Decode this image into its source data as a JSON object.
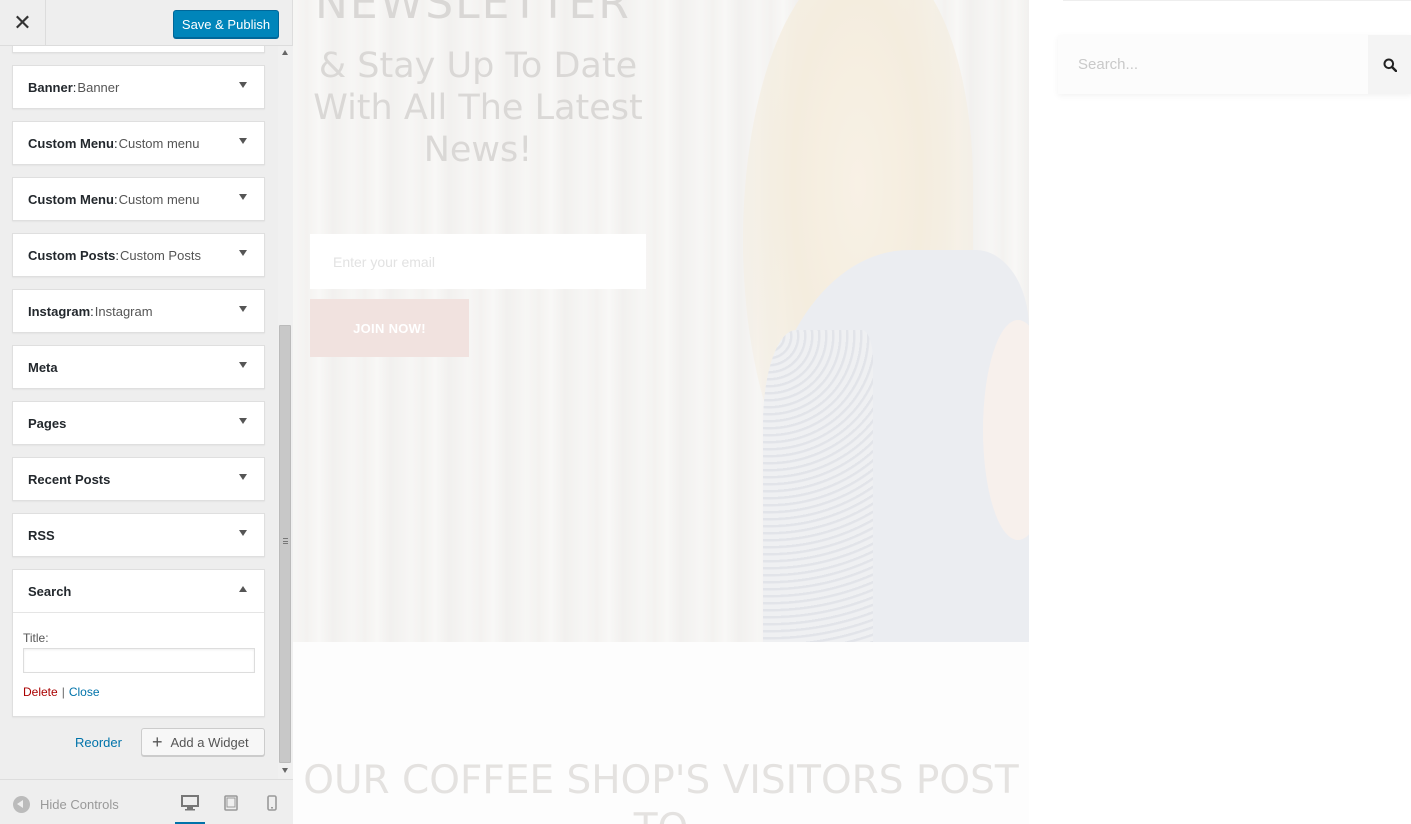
{
  "topbar": {
    "close_icon": "✕",
    "publish_label": "Save & Publish"
  },
  "widgets": [
    {
      "name": "Banner",
      "sub": "Banner"
    },
    {
      "name": "Custom Menu",
      "sub": "Custom menu"
    },
    {
      "name": "Custom Menu",
      "sub": "Custom menu"
    },
    {
      "name": "Custom Posts",
      "sub": "Custom Posts"
    },
    {
      "name": "Instagram",
      "sub": "Instagram"
    },
    {
      "name": "Meta",
      "sub": ""
    },
    {
      "name": "Pages",
      "sub": ""
    },
    {
      "name": "Recent Posts",
      "sub": ""
    },
    {
      "name": "RSS",
      "sub": ""
    }
  ],
  "search_widget": {
    "name": "Search",
    "title_label": "Title:",
    "title_value": "",
    "delete_label": "Delete",
    "separator": "|",
    "close_label": "Close"
  },
  "panel_actions": {
    "reorder_label": "Reorder",
    "add_widget_label": "Add a Widget"
  },
  "footer": {
    "hide_controls_label": "Hide Controls",
    "devices": [
      "desktop",
      "tablet",
      "mobile"
    ],
    "active_device": "desktop"
  },
  "preview": {
    "newsletter_title": "NEWSLETTER",
    "subtitle": "& Stay Up To Date With All The Latest News!",
    "email_placeholder": "Enter your email",
    "join_label": "JOIN NOW!",
    "coffee_heading": "OUR COFFEE SHOP'S VISITORS POST TO",
    "search_placeholder": "Search..."
  },
  "colors": {
    "primary_button": "#0085ba",
    "link": "#0073aa",
    "delete": "#aa0000"
  }
}
